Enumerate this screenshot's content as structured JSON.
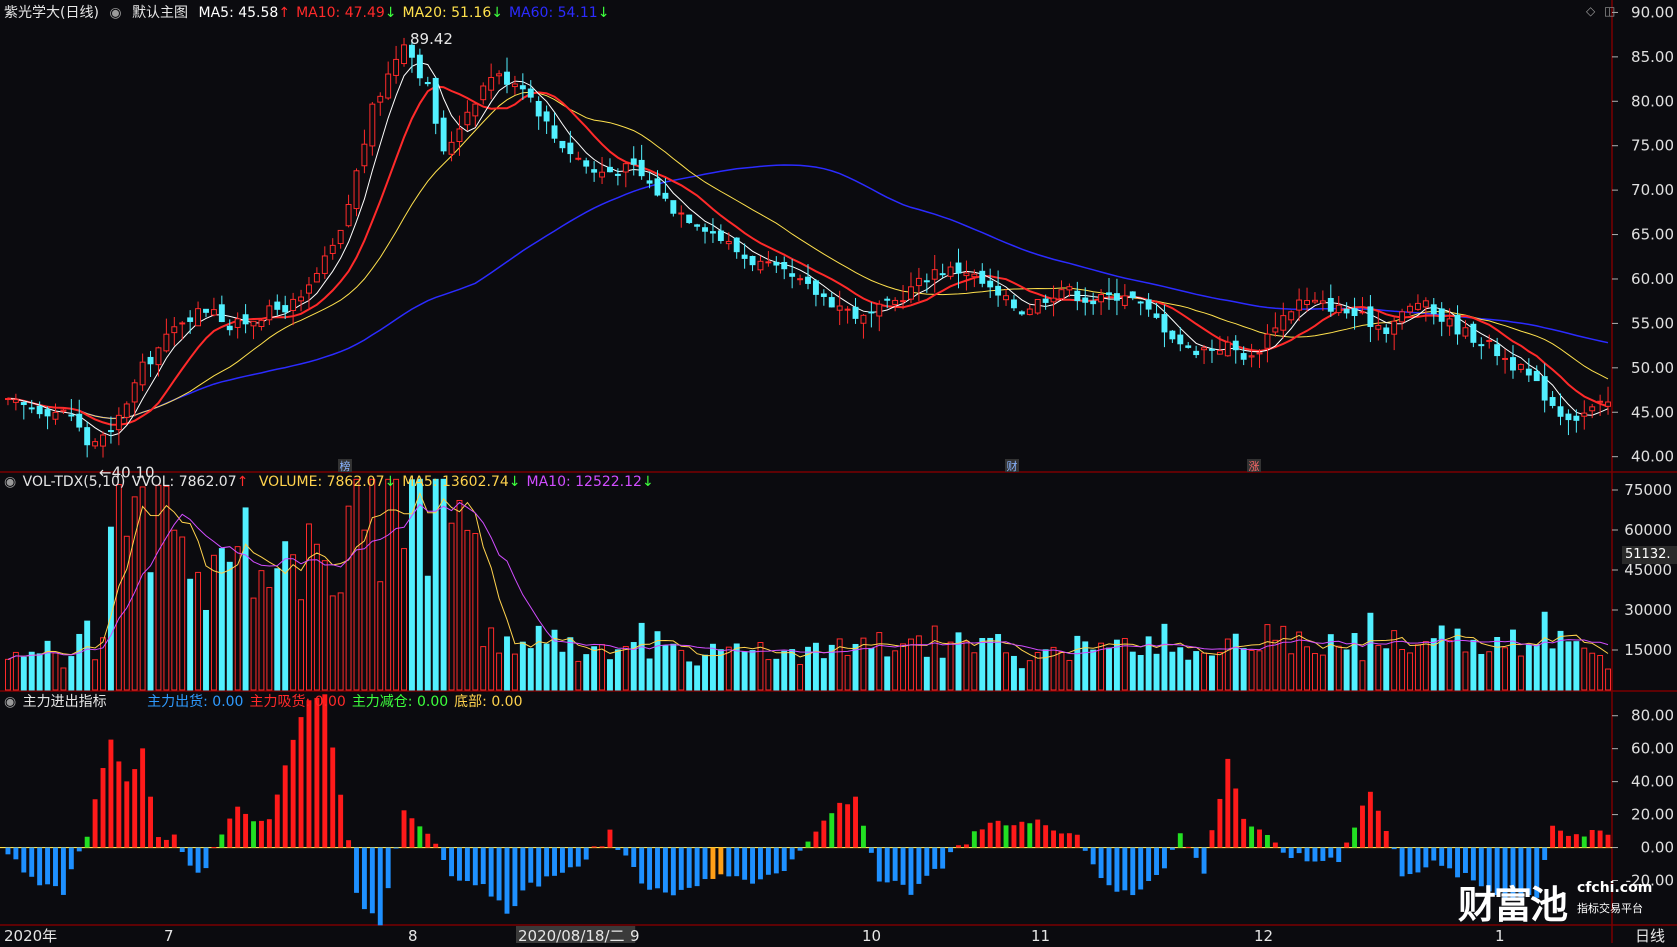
{
  "stock": {
    "title": "紫光学大(日线)",
    "main_chart_name": "默认主图",
    "ma_labels": [
      {
        "text": "MA5: 45.58",
        "arrow": "↑",
        "color": "#ffffff"
      },
      {
        "text": "MA10: 47.49",
        "arrow": "↓",
        "color": "#ff2a2a"
      },
      {
        "text": "MA20: 51.16",
        "arrow": "↓",
        "color": "#ffe14d"
      },
      {
        "text": "MA60: 54.11",
        "arrow": "↓",
        "color": "#2b2bff"
      }
    ]
  },
  "volume_panel": {
    "name": "VOL-TDX(5,10)",
    "vvol": "VVOL: 7862.07",
    "vvol_arrow": "↑",
    "labels": [
      {
        "text": "VOLUME: 7862.07",
        "arrow": "↓",
        "color": "#ffd24d"
      },
      {
        "text": "MA5: 13602.74",
        "arrow": "↓",
        "color": "#ffd24d"
      },
      {
        "text": "MA10: 12522.12",
        "arrow": "↓",
        "color": "#d14dff"
      }
    ],
    "current_value_tag": "51132."
  },
  "indicator_panel": {
    "name": "主力进出指标",
    "labels": [
      {
        "text": "主力出货: 0.00",
        "color": "#2f9bff"
      },
      {
        "text": "主力吸货: 0.00",
        "color": "#ff2a2a"
      },
      {
        "text": "主力减仓: 0.00",
        "color": "#3dff3d"
      },
      {
        "text": "底部: 0.00",
        "color": "#ffd24d"
      }
    ]
  },
  "annotations": {
    "high": "89.42",
    "low": "←40.10",
    "event_markers": [
      "榜",
      "财",
      "涨"
    ]
  },
  "bottom_axis": {
    "labels": [
      "2020年",
      "7",
      "8",
      "2020/08/18/二",
      "9",
      "10",
      "11",
      "12",
      "1"
    ],
    "period": "日线"
  },
  "watermark": {
    "brand": "财富池",
    "domain": "cfchi.com",
    "slogan": "指标交易平台"
  },
  "colors": {
    "up": "#ff2a2a",
    "down": "#52f0ff",
    "ma5": "#ffffff",
    "ma10": "#ff2a2a",
    "ma20": "#ffe14d",
    "ma60": "#2b2bff",
    "vol_ma5": "#ffd24d",
    "vol_ma10": "#d14dff",
    "out": "#1e90ff",
    "in": "#ff1a1a",
    "reduce": "#22e022",
    "bottom": "#ffa018",
    "grid": "#7a0000",
    "bg": "#0b0b0f"
  },
  "chart_data": {
    "type": "candlestick",
    "x_axis_labels": [
      "2020年",
      "7",
      "8",
      "9",
      "10",
      "11",
      "12",
      "1"
    ],
    "price_axis": {
      "ticks": [
        40,
        45,
        50,
        55,
        60,
        65,
        70,
        75,
        80,
        85,
        90
      ],
      "ylim": [
        38.5,
        90.5
      ]
    },
    "price_keypoints": [
      [
        0,
        46.0
      ],
      [
        8,
        44.8
      ],
      [
        10,
        41.5
      ],
      [
        13,
        42.5
      ],
      [
        17,
        50.0
      ],
      [
        22,
        55.5
      ],
      [
        26,
        57.0
      ],
      [
        28,
        54.5
      ],
      [
        32,
        56.0
      ],
      [
        37,
        57.5
      ],
      [
        42,
        65.0
      ],
      [
        46,
        79.0
      ],
      [
        50,
        87.0
      ],
      [
        53,
        81.5
      ],
      [
        55,
        74.0
      ],
      [
        58,
        79.0
      ],
      [
        61,
        83.0
      ],
      [
        65,
        82.0
      ],
      [
        69,
        76.0
      ],
      [
        74,
        72.0
      ],
      [
        79,
        72.5
      ],
      [
        84,
        68.0
      ],
      [
        88,
        66.0
      ],
      [
        93,
        62.5
      ],
      [
        98,
        60.5
      ],
      [
        102,
        58.5
      ],
      [
        108,
        55.5
      ],
      [
        112,
        57.5
      ],
      [
        117,
        61.0
      ],
      [
        121,
        61.0
      ],
      [
        125,
        58.0
      ],
      [
        128,
        56.5
      ],
      [
        133,
        59.0
      ],
      [
        137,
        57.5
      ],
      [
        141,
        58.5
      ],
      [
        145,
        55.5
      ],
      [
        149,
        52.0
      ],
      [
        154,
        52.5
      ],
      [
        157,
        51.0
      ],
      [
        160,
        55.0
      ],
      [
        163,
        57.5
      ],
      [
        167,
        57.0
      ],
      [
        170,
        56.0
      ],
      [
        174,
        54.5
      ],
      [
        178,
        57.5
      ],
      [
        182,
        55.0
      ],
      [
        187,
        52.5
      ],
      [
        192,
        49.0
      ],
      [
        196,
        45.0
      ],
      [
        198,
        44.5
      ],
      [
        202,
        46.0
      ]
    ],
    "ma_series": [
      {
        "name": "MA5",
        "value": 45.58
      },
      {
        "name": "MA10",
        "value": 47.49
      },
      {
        "name": "MA20",
        "value": 51.16
      },
      {
        "name": "MA60",
        "value": 54.11
      }
    ],
    "volume_axis": {
      "ticks": [
        15000,
        30000,
        45000,
        60000,
        75000
      ],
      "ylim": [
        0,
        81000
      ]
    },
    "volume_last": 7862.07,
    "volume_ma5": 13602.74,
    "volume_ma10": 12522.12,
    "indicator_axis": {
      "ticks": [
        -20,
        0,
        20,
        40,
        60,
        80
      ],
      "ylim": [
        -47,
        95
      ]
    },
    "indicator_keypoints": [
      [
        0,
        -5
      ],
      [
        4,
        -20
      ],
      [
        7,
        -28
      ],
      [
        10,
        8
      ],
      [
        13,
        68
      ],
      [
        15,
        40
      ],
      [
        17,
        58
      ],
      [
        19,
        8
      ],
      [
        21,
        6
      ],
      [
        24,
        -18
      ],
      [
        27,
        5
      ],
      [
        29,
        25
      ],
      [
        31,
        18
      ],
      [
        33,
        18
      ],
      [
        36,
        65
      ],
      [
        38,
        92
      ],
      [
        40,
        92
      ],
      [
        42,
        35
      ],
      [
        44,
        -30
      ],
      [
        47,
        -45
      ],
      [
        50,
        25
      ],
      [
        53,
        10
      ],
      [
        56,
        -20
      ],
      [
        60,
        -25
      ],
      [
        63,
        -38
      ],
      [
        66,
        -22
      ],
      [
        70,
        -18
      ],
      [
        76,
        8
      ],
      [
        80,
        -22
      ],
      [
        85,
        -28
      ],
      [
        90,
        -15
      ],
      [
        95,
        -20
      ],
      [
        99,
        -10
      ],
      [
        104,
        22
      ],
      [
        107,
        30
      ],
      [
        110,
        -18
      ],
      [
        114,
        -28
      ],
      [
        118,
        -10
      ],
      [
        123,
        12
      ],
      [
        127,
        15
      ],
      [
        131,
        15
      ],
      [
        135,
        8
      ],
      [
        139,
        -25
      ],
      [
        142,
        -28
      ],
      [
        146,
        -10
      ],
      [
        148,
        8
      ],
      [
        151,
        -14
      ],
      [
        154,
        55
      ],
      [
        156,
        18
      ],
      [
        159,
        5
      ],
      [
        161,
        -2
      ],
      [
        164,
        -8
      ],
      [
        168,
        -6
      ],
      [
        172,
        35
      ],
      [
        174,
        10
      ],
      [
        176,
        -15
      ],
      [
        180,
        -10
      ],
      [
        184,
        -18
      ],
      [
        188,
        -28
      ],
      [
        191,
        -30
      ],
      [
        193,
        -28
      ],
      [
        195,
        15
      ],
      [
        197,
        8
      ]
    ]
  }
}
